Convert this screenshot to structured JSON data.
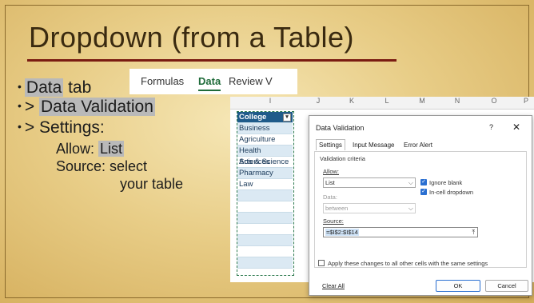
{
  "slide": {
    "title": "Dropdown (from a Table)",
    "bullets": {
      "b1_bold": "Data",
      "b1_rest": " tab",
      "b2_prefix": ">",
      "b2_bold": "Data Validation",
      "b3_prefix": ">",
      "b3_text": "Settings:",
      "allow_label": "Allow:",
      "allow_value": "List",
      "source_line1": "Source: select",
      "source_line2": "your table"
    }
  },
  "ribbon": {
    "tabs": [
      "Formulas",
      "Data",
      "Review",
      "V"
    ],
    "active": "Data"
  },
  "sheet": {
    "columns": [
      "I",
      "J",
      "K",
      "L",
      "M",
      "N",
      "O",
      "P"
    ],
    "table_header": "College",
    "table_rows": [
      "Business",
      "Agriculture",
      "Health Sciences",
      "Arts & Science",
      "Pharmacy",
      "Law"
    ]
  },
  "dialog": {
    "title": "Data Validation",
    "help": "?",
    "close": "✕",
    "tabs": [
      "Settings",
      "Input Message",
      "Error Alert"
    ],
    "section": "Validation criteria",
    "allow_label": "Allow:",
    "allow_value": "List",
    "ignore_blank": "Ignore blank",
    "in_cell": "In-cell dropdown",
    "data_label": "Data:",
    "data_value": "between",
    "source_label": "Source:",
    "source_value": "=$I$2:$I$14",
    "apply_all": "Apply these changes to all other cells with the same settings",
    "clear_all": "Clear All",
    "ok": "OK",
    "cancel": "Cancel"
  },
  "colors": {
    "accent_line": "#7a1c12",
    "excel_green": "#1f6b3a",
    "table_header": "#1f5b8a",
    "checkbox_blue": "#2a6fd1"
  }
}
